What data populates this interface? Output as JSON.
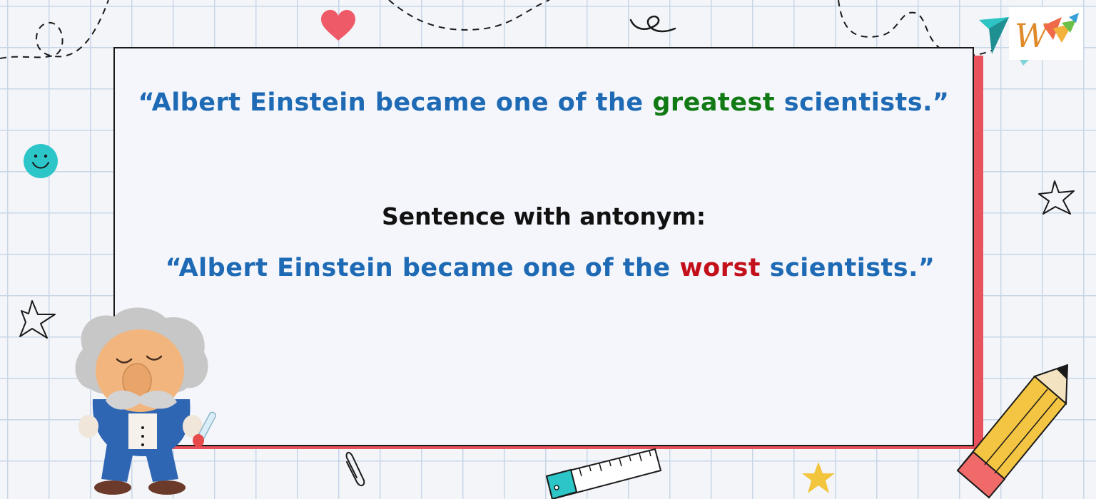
{
  "slide": {
    "original": {
      "open": "“Albert Einstein became one of the ",
      "word": "greatest",
      "close": " scientists.”"
    },
    "heading": "Sentence with antonym:",
    "antonym": {
      "open": "“Albert Einstein became one of the ",
      "word": "worst",
      "close": " scientists.”"
    }
  },
  "logo": {
    "letter": "W"
  },
  "colors": {
    "quote_text": "#1e6ab5",
    "original_word": "#117a14",
    "antonym_word": "#c4101a",
    "card_shadow": "#e9525c",
    "grid_line": "#c8d6e8"
  },
  "decorations": [
    "doodle-circle",
    "heart-icon",
    "loop-doodle",
    "smiley-icon",
    "star-outline-icon",
    "paper-clip-icon",
    "ruler-icon",
    "star-icon",
    "pencil-icon",
    "einstein-character",
    "paper-plane-icon"
  ]
}
